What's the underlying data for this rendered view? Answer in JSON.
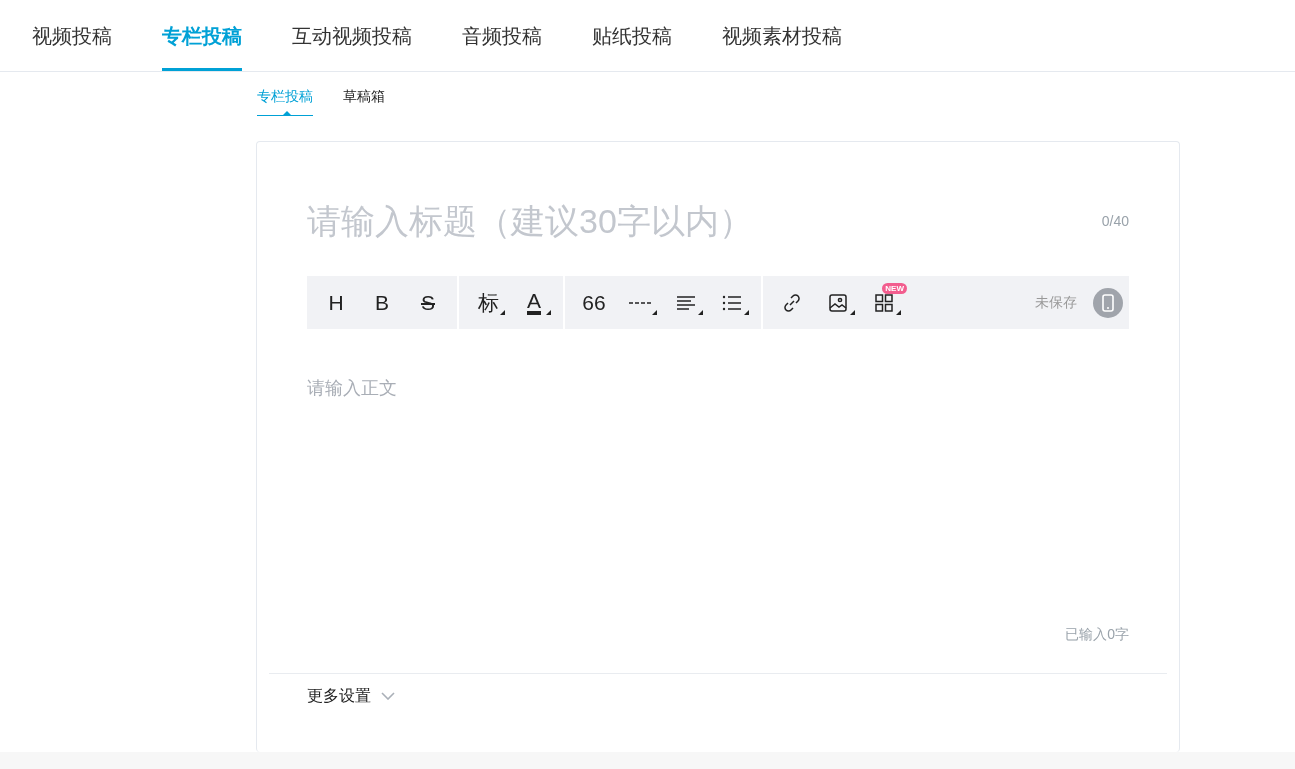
{
  "tabs": [
    {
      "label": "视频投稿",
      "selected": false
    },
    {
      "label": "专栏投稿",
      "selected": true
    },
    {
      "label": "互动视频投稿",
      "selected": false
    },
    {
      "label": "音频投稿",
      "selected": false
    },
    {
      "label": "贴纸投稿",
      "selected": false
    },
    {
      "label": "视频素材投稿",
      "selected": false
    }
  ],
  "subtabs": [
    {
      "label": "专栏投稿",
      "selected": true
    },
    {
      "label": "草稿箱",
      "selected": false
    }
  ],
  "editor": {
    "title_placeholder": "请输入标题（建议30字以内）",
    "title_counter": "0/40",
    "toolbar": [
      [
        {
          "kind": "text",
          "label": "H",
          "dropdown": false
        },
        {
          "kind": "text",
          "label": "B",
          "dropdown": false
        },
        {
          "kind": "strike",
          "label": "S",
          "dropdown": false
        }
      ],
      [
        {
          "kind": "text",
          "label": "标",
          "dropdown": true
        },
        {
          "kind": "color",
          "label": "A",
          "dropdown": true
        }
      ],
      [
        {
          "kind": "text",
          "label": "66",
          "dropdown": false
        },
        {
          "kind": "divider",
          "dropdown": true
        },
        {
          "kind": "align",
          "dropdown": true
        },
        {
          "kind": "list",
          "dropdown": true
        }
      ],
      [
        {
          "kind": "link",
          "dropdown": false
        },
        {
          "kind": "image",
          "dropdown": true
        },
        {
          "kind": "grid",
          "dropdown": true,
          "badge": "NEW"
        }
      ]
    ],
    "save_status": "未保存",
    "body_placeholder": "请输入正文",
    "word_count": "已输入0字",
    "more_settings": "更多设置"
  }
}
